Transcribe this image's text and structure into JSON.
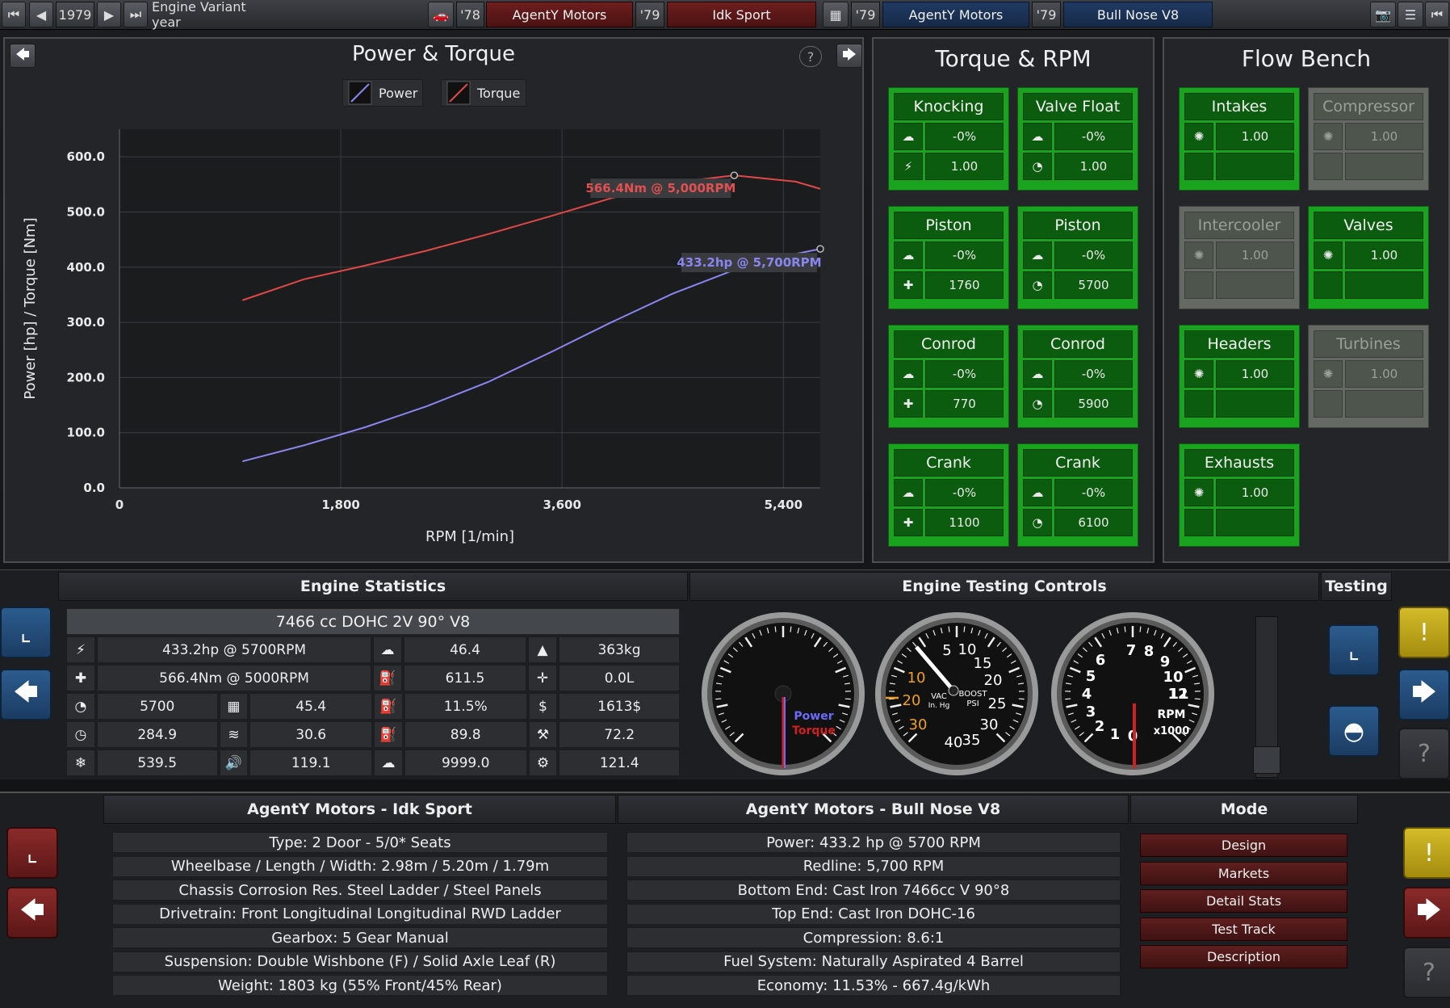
{
  "topbar": {
    "year": "1979",
    "variant_label": "Engine Variant year",
    "car_year_1": "'78",
    "car_make": "AgentY Motors",
    "car_year_2": "'79",
    "car_model": "Idk Sport",
    "engine_year_1": "'79",
    "engine_make": "AgentY Motors",
    "engine_year_2": "'79",
    "engine_model": "Bull Nose V8"
  },
  "power_torque": {
    "title": "Power & Torque",
    "legend_power": "Power",
    "legend_torque": "Torque",
    "help": "?",
    "annotation_torque": "566.4Nm @ 5,000RPM",
    "annotation_power": "433.2hp @ 5,700RPM"
  },
  "chart_data": {
    "type": "line",
    "title": "Power & Torque",
    "xlabel": "RPM [1/min]",
    "ylabel": "Power [hp] / Torque [Nm]",
    "xlim": [
      0,
      5700
    ],
    "ylim": [
      0,
      650
    ],
    "xticks": [
      0,
      1800,
      3600,
      5400
    ],
    "xtick_labels": [
      "0",
      "1,800",
      "3,600",
      "5,400"
    ],
    "yticks": [
      0,
      100,
      200,
      300,
      400,
      500,
      600
    ],
    "ytick_labels": [
      "0.0",
      "100.0",
      "200.0",
      "300.0",
      "400.0",
      "500.0",
      "600.0"
    ],
    "grid": true,
    "legend_position": "top-center",
    "x": [
      1000,
      1500,
      2000,
      2500,
      3000,
      3500,
      4000,
      4500,
      5000,
      5500,
      5700
    ],
    "series": [
      {
        "name": "Power",
        "color": "#8a86f0",
        "values": [
          48,
          77,
          110,
          148,
          192,
          245,
          300,
          352,
          395,
          424,
          433.2
        ]
      },
      {
        "name": "Torque",
        "color": "#e04848",
        "values": [
          340,
          378,
          403,
          430,
          460,
          492,
          525,
          553,
          566.4,
          555,
          542
        ]
      }
    ]
  },
  "torque_rpm": {
    "title": "Torque & RPM",
    "boxes": [
      {
        "title": "Knocking",
        "row1_icon": "☁",
        "row1_value": "-0%",
        "row2_icon": "⚡",
        "row2_value": "1.00"
      },
      {
        "title": "Valve Float",
        "row1_icon": "☁",
        "row1_value": "-0%",
        "row2_icon": "◔",
        "row2_value": "1.00"
      },
      {
        "title": "Piston",
        "row1_icon": "☁",
        "row1_value": "-0%",
        "row2_icon": "✚",
        "row2_value": "1760"
      },
      {
        "title": "Piston",
        "row1_icon": "☁",
        "row1_value": "-0%",
        "row2_icon": "◔",
        "row2_value": "5700"
      },
      {
        "title": "Conrod",
        "row1_icon": "☁",
        "row1_value": "-0%",
        "row2_icon": "✚",
        "row2_value": "770"
      },
      {
        "title": "Conrod",
        "row1_icon": "☁",
        "row1_value": "-0%",
        "row2_icon": "◔",
        "row2_value": "5900"
      },
      {
        "title": "Crank",
        "row1_icon": "☁",
        "row1_value": "-0%",
        "row2_icon": "✚",
        "row2_value": "1100"
      },
      {
        "title": "Crank",
        "row1_icon": "☁",
        "row1_value": "-0%",
        "row2_icon": "◔",
        "row2_value": "6100"
      }
    ]
  },
  "flow_bench": {
    "title": "Flow Bench",
    "boxes": [
      {
        "title": "Intakes",
        "value": "1.00",
        "active": "yes"
      },
      {
        "title": "Compressor",
        "value": "1.00",
        "active": "no"
      },
      {
        "title": "Intercooler",
        "value": "1.00",
        "active": "no"
      },
      {
        "title": "Valves",
        "value": "1.00",
        "active": "yes"
      },
      {
        "title": "Headers",
        "value": "1.00",
        "active": "yes"
      },
      {
        "title": "Turbines",
        "value": "1.00",
        "active": "no"
      },
      {
        "title": "Exhausts",
        "value": "1.00",
        "active": "yes"
      }
    ]
  },
  "engine_stats": {
    "title": "Engine Statistics",
    "engine_desc": "7466 cc DOHC 2V 90° V8",
    "power": "433.2hp @ 5700RPM",
    "torque": "566.4Nm @ 5000RPM",
    "rpm": "5700",
    "val_284": "284.9",
    "val_539": "539.5",
    "val_45": "45.4",
    "val_30": "30.6",
    "val_119": "119.1",
    "val_46": "46.4",
    "val_611": "611.5",
    "val_11": "11.5%",
    "val_89": "89.8",
    "val_9999": "9999.0",
    "weight": "363kg",
    "volume": "0.0L",
    "cost": "1613$",
    "val_72": "72.2",
    "val_121": "121.4"
  },
  "testing_controls": {
    "title": "Engine Testing Controls",
    "testing_label": "Testing",
    "gauge1_power": "Power",
    "gauge1_torque": "Torque",
    "gauge2_vac": "VAC",
    "gauge2_inhg": "In. Hg",
    "gauge2_boost": "BOOST",
    "gauge2_psi": "PSI",
    "gauge2_ticks": [
      "5",
      "10",
      "15",
      "20",
      "25",
      "30",
      "35",
      "40",
      "10",
      "20",
      "30"
    ],
    "gauge3_rpm": "RPM",
    "gauge3_x1000": "x1000",
    "gauge3_ticks": [
      "0",
      "1",
      "2",
      "3",
      "4",
      "5",
      "6",
      "7",
      "8",
      "9",
      "10",
      "11",
      "12"
    ]
  },
  "car_info": {
    "title": "AgentY Motors - Idk Sport",
    "lines": [
      "Type: 2 Door - 5/0* Seats",
      "Wheelbase / Length / Width: 2.98m / 5.20m / 1.79m",
      "Chassis Corrosion Res. Steel Ladder / Steel Panels",
      "Drivetrain: Front Longitudinal Longitudinal RWD Ladder",
      "Gearbox: 5 Gear Manual",
      "Suspension: Double Wishbone (F) / Solid Axle Leaf (R)",
      "Weight: 1803 kg (55% Front/45% Rear)"
    ]
  },
  "engine_info": {
    "title": "AgentY Motors - Bull Nose V8",
    "lines": [
      "Power: 433.2 hp @ 5700 RPM",
      "Redline:  5,700 RPM",
      "Bottom End: Cast Iron 7466cc V 90°8",
      "Top End: Cast Iron DOHC-16",
      "Compression: 8.6:1",
      "Fuel System: Naturally Aspirated 4 Barrel",
      "Economy: 11.53% - 667.4g/kWh"
    ]
  },
  "mode": {
    "title": "Mode",
    "items": [
      "Design",
      "Markets",
      "Detail Stats",
      "Test Track",
      "Description"
    ]
  }
}
